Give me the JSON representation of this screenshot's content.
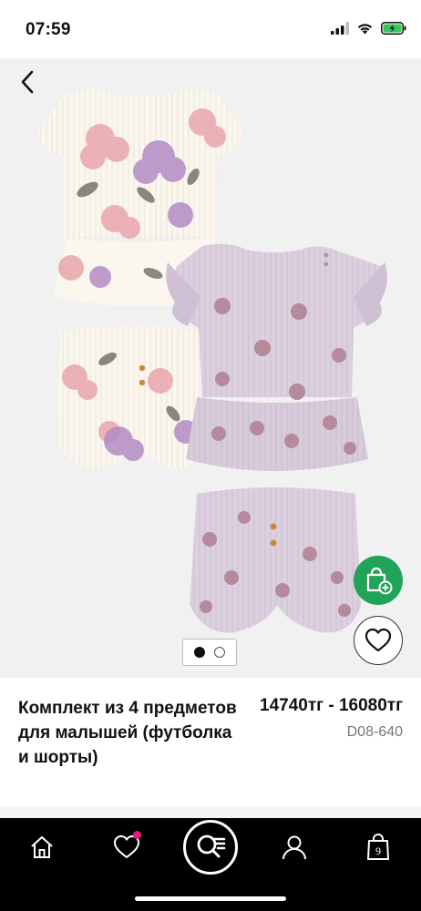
{
  "status_bar": {
    "time": "07:59"
  },
  "product": {
    "title": "Комплект из 4 предметов для малышей (футболка и шорты)",
    "price": "14740тг - 16080тг",
    "sku": "D08-640",
    "image_count": 2,
    "active_image": 1
  },
  "nav": {
    "items": [
      "home-icon",
      "wishlist-icon",
      "search-icon",
      "account-icon",
      "bag-icon"
    ],
    "bag_count": "9"
  },
  "colors": {
    "cart_green": "#22a35a",
    "badge_pink": "#e8197a",
    "nav_bg": "#000000"
  }
}
